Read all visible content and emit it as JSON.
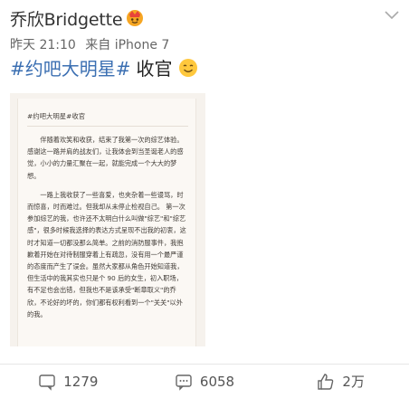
{
  "post": {
    "author": "乔欣Bridgette",
    "crown_badge": "crown-icon",
    "time": "昨天 21:10",
    "source": "来自 iPhone 7",
    "hashtag": "#约吧大明星#",
    "text": "收官",
    "emoji": "smile-icon"
  },
  "image": {
    "title": "#约吧大明星#收官",
    "paragraphs": [
      "伴随着欢笑和收获，结束了我第一次的综艺体验。感谢这一路并肩的战友们，让我体会到当圣诞老人的感觉，小小的力量汇聚在一起，就能完成一个大大的梦想。",
      "一路上我收获了一些喜爱，也夹杂着一些谩骂，时而惊喜，时而难过。但我却从未停止检视自己。 第一次参加综艺的我，也许还不太明白什么叫做\"综艺\"和\"综艺感\"，很多时候我选择的表达方式呈现不出我的初衷，这时才知道一切都没那么简单。之前的消防服事件，我抱歉着开始在对待制服穿着上有疏忽，没有用一个最严谨的态度而产生了误会。虽然大家都从角色开始知道我，但生活中的我其实也只是个 90 后的女生，初入职场，有不足也会出错，但我也不是该承受\"断章取义\"的乔欣，不论好的坏的，你们都有权利看到一个\"关关\"以外的我。"
    ]
  },
  "actions": {
    "repost_count": "1279",
    "comment_count": "6058",
    "like_count": "2万",
    "repost_icon": "repost-icon",
    "comment_icon": "comment-icon",
    "like_icon": "thumbs-up-icon"
  },
  "colors": {
    "hashtag": "#3b6fb2",
    "badge_orange": "#f29a2e"
  }
}
